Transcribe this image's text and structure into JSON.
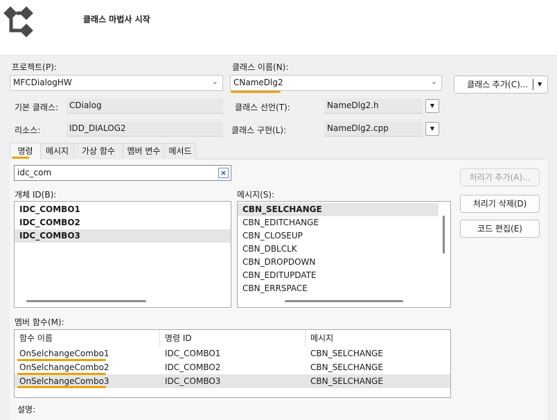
{
  "header": {
    "title": "클래스 마법사 시작"
  },
  "project": {
    "label": "프로젝트(P):",
    "value": "MFCDialogHW"
  },
  "class_name": {
    "label": "클래스 이름(N):",
    "value": "CNameDlg2"
  },
  "add_class_button": "클래스 추가(C)...",
  "base_class": {
    "label": "기본 클래스:",
    "value": "CDialog"
  },
  "resource": {
    "label": "리소스:",
    "value": "IDD_DIALOG2"
  },
  "class_decl": {
    "label": "클래스 선언(T):",
    "value": "NameDlg2.h"
  },
  "class_impl": {
    "label": "클래스 구현(L):",
    "value": "NameDlg2.cpp"
  },
  "tabs": [
    "명령",
    "메시지",
    "가상 함수",
    "멤버 변수",
    "메서드"
  ],
  "search": {
    "value": "idc_com"
  },
  "object_ids": {
    "label": "개체 ID(B):",
    "items": [
      "IDC_COMBO1",
      "IDC_COMBO2",
      "IDC_COMBO3"
    ]
  },
  "messages": {
    "label": "메시지(S):",
    "items": [
      "CBN_SELCHANGE",
      "CBN_EDITCHANGE",
      "CBN_CLOSEUP",
      "CBN_DBLCLK",
      "CBN_DROPDOWN",
      "CBN_EDITUPDATE",
      "CBN_ERRSPACE"
    ]
  },
  "buttons": {
    "add_handler": "처리기 추가(A)...",
    "delete_handler": "처리기 삭제(D)",
    "edit_code": "코드 편집(E)"
  },
  "member_functions": {
    "label": "멤버 함수(M):",
    "columns": [
      "함수 이름",
      "명령 ID",
      "메시지"
    ],
    "rows": [
      [
        "OnSelchangeCombo1",
        "IDC_COMBO1",
        "CBN_SELCHANGE"
      ],
      [
        "OnSelchangeCombo2",
        "IDC_COMBO2",
        "CBN_SELCHANGE"
      ],
      [
        "OnSelchangeCombo3",
        "IDC_COMBO3",
        "CBN_SELCHANGE"
      ]
    ]
  },
  "description": {
    "label": "설명:"
  },
  "colors": {
    "highlight": "#f0a000",
    "selected_row": "#e5e5e5"
  }
}
